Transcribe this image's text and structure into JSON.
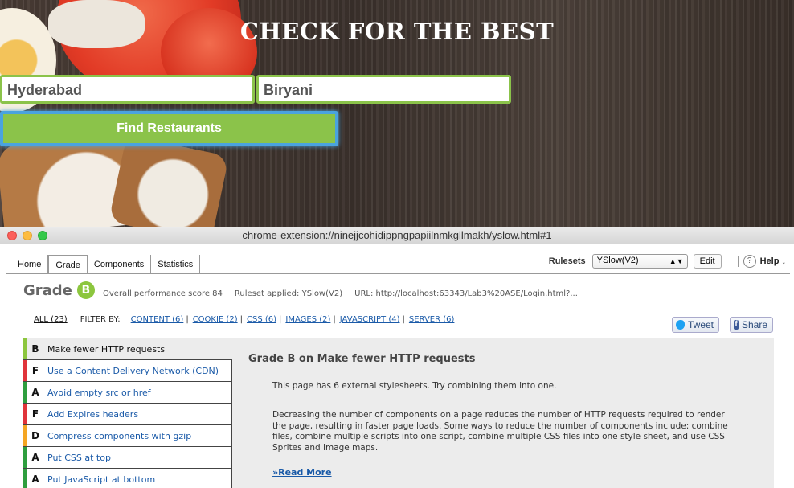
{
  "hero": {
    "title": "CHECK FOR THE BEST",
    "location_value": "Hyderabad",
    "food_value": "Biryani",
    "find_button": "Find Restaurants"
  },
  "window": {
    "url": "chrome-extension://ninejjcohidippngpapiilnmkgllmakh/yslow.html#1"
  },
  "tabs": [
    {
      "label": "Home"
    },
    {
      "label": "Grade",
      "active": true
    },
    {
      "label": "Components"
    },
    {
      "label": "Statistics"
    }
  ],
  "toolbar": {
    "rulesets_label": "Rulesets",
    "ruleset_selected": "YSlow(V2)",
    "edit_label": "Edit",
    "help_icon": "?",
    "help_label": "Help ↓"
  },
  "grade": {
    "title": "Grade",
    "letter": "B",
    "score_text": "Overall performance score 84",
    "ruleset_text": "Ruleset applied: YSlow(V2)",
    "url_text": "URL: http://localhost:63343/Lab3%20ASE/Login.html?..."
  },
  "filters": {
    "all": "ALL (23)",
    "filter_by": "FILTER BY:",
    "items": [
      "CONTENT (6)",
      "COOKIE (2)",
      "CSS (6)",
      "IMAGES (2)",
      "JAVASCRIPT (4)",
      "SERVER (6)"
    ]
  },
  "social": {
    "tweet": "Tweet",
    "share": "Share",
    "fb_glyph": "f"
  },
  "rules": [
    {
      "grade": "B",
      "title": "Make fewer HTTP requests",
      "color": "#8cc63e"
    },
    {
      "grade": "F",
      "title": "Use a Content Delivery Network (CDN)",
      "color": "#e0343a"
    },
    {
      "grade": "A",
      "title": "Avoid empty src or href",
      "color": "#2e9e3e"
    },
    {
      "grade": "F",
      "title": "Add Expires headers",
      "color": "#e0343a"
    },
    {
      "grade": "D",
      "title": "Compress components with gzip",
      "color": "#f5a623"
    },
    {
      "grade": "A",
      "title": "Put CSS at top",
      "color": "#2e9e3e"
    },
    {
      "grade": "A",
      "title": "Put JavaScript at bottom",
      "color": "#2e9e3e"
    }
  ],
  "detail": {
    "title": "Grade B on Make fewer HTTP requests",
    "message": "This page has 6 external stylesheets. Try combining them into one.",
    "description": "Decreasing the number of components on a page reduces the number of HTTP requests required to render the page, resulting in faster page loads. Some ways to reduce the number of components include: combine files, combine multiple scripts into one script, combine multiple CSS files into one style sheet, and use CSS Sprites and image maps.",
    "read_more": "»Read More"
  }
}
